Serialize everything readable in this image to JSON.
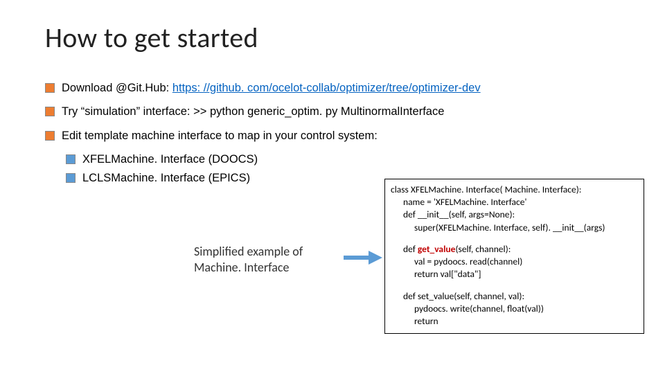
{
  "title": "How to get started",
  "bullets": {
    "b1_prefix": "Download @Git.Hub:  ",
    "b1_link": "https: //github. com/ocelot-collab/optimizer/tree/optimizer-dev",
    "b2": "Try “simulation” interface: >> python generic_optim. py MultinormalInterface",
    "b3": "Edit template machine interface to map in your control system:",
    "b3a": "XFELMachine. Interface (DOOCS)",
    "b3b": "LCLSMachine. Interface (EPICS)"
  },
  "caption": "Simplified example of Machine. Interface",
  "code": {
    "c1": "class XFELMachine. Interface( Machine. Interface):",
    "c2": "name = 'XFELMachine. Interface'",
    "c3": "def __init__(self, args=None):",
    "c4": "super(XFELMachine. Interface, self). __init__(args)",
    "d1a": "def ",
    "d1b": "get_value",
    "d1c": "(self, channel):",
    "d2": "val = pydoocs. read(channel)",
    "d3": "return val[\"data\"]",
    "e1": "def set_value(self, channel, val):",
    "e2": "pydoocs. write(channel, float(val))",
    "e3": "return"
  }
}
